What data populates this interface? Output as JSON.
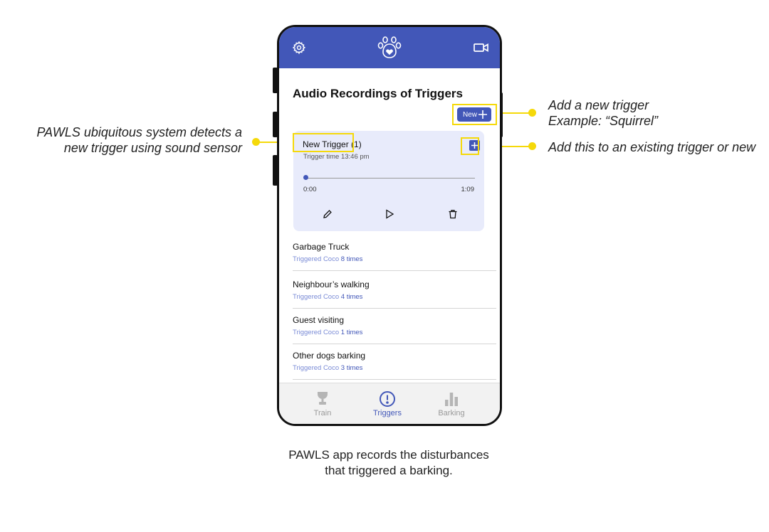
{
  "annotations": {
    "left_line1": "PAWLS ubiquitous system detects a",
    "left_line2": "new trigger using sound sensor",
    "right1_line1": "Add a new trigger",
    "right1_line2": "Example: “Squirrel”",
    "right2": "Add this to an existing trigger or new"
  },
  "caption": {
    "line1": "PAWLS app records the disturbances",
    "line2": "that triggered a barking."
  },
  "app": {
    "header": {
      "left_icon": "gear-icon",
      "center_icon": "paw-logo-icon",
      "right_icon": "video-camera-icon",
      "color": "#4257b8"
    },
    "title": "Audio Recordings of Triggers",
    "new_button": "New",
    "new_trigger": {
      "title": "New Trigger (1)",
      "subtitle": "Trigger time 13:46 pm",
      "time_start": "0:00",
      "time_end": "1:09",
      "progress": 0.0
    },
    "triggers": [
      {
        "title": "Garbage Truck",
        "prefix": "Triggered Coco",
        "count": "8 times"
      },
      {
        "title": "Neighbour’s walking",
        "prefix": "Triggered Coco",
        "count": "4 times"
      },
      {
        "title": "Guest visiting",
        "prefix": "Triggered Coco",
        "count": "1 times"
      },
      {
        "title": "Other dogs barking",
        "prefix": "Triggered Coco",
        "count": "3 times"
      }
    ],
    "nav": [
      {
        "label": "Train",
        "icon": "trophy-icon",
        "active": false
      },
      {
        "label": "Triggers",
        "icon": "alert-circle-icon",
        "active": true
      },
      {
        "label": "Barking",
        "icon": "bar-chart-icon",
        "active": false
      }
    ],
    "accent": "#4257b8",
    "highlight": "#f5d90a"
  }
}
